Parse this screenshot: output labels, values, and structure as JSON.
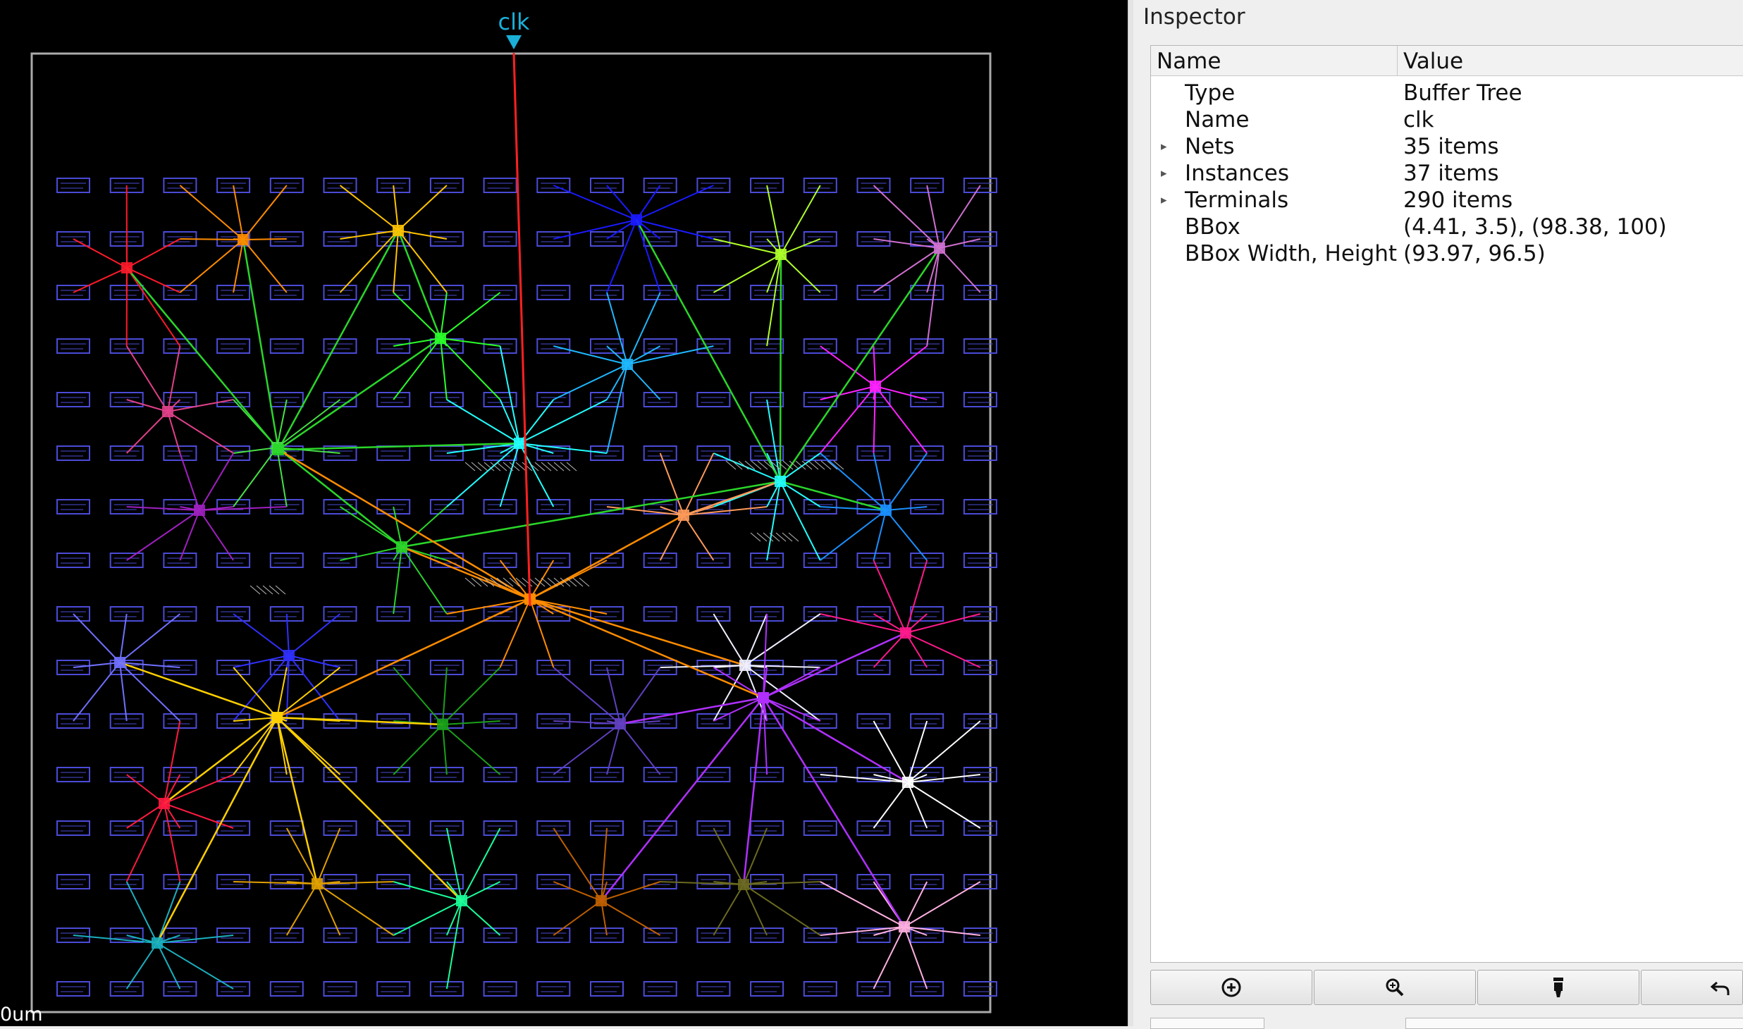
{
  "layout": {
    "clock_pin_label": "clk",
    "scale_label": "0um",
    "bbox_highlight_color": "#aaaaaa",
    "cell_color": "#4b4bd8",
    "root_net_color": "#ff2020"
  },
  "inspector": {
    "title": "Inspector",
    "columns": {
      "name": "Name",
      "value": "Value"
    },
    "rows": [
      {
        "name": "Type",
        "value": "Buffer Tree",
        "expandable": false
      },
      {
        "name": "Name",
        "value": "clk",
        "expandable": false
      },
      {
        "name": "Nets",
        "value": "35 items",
        "expandable": true
      },
      {
        "name": "Instances",
        "value": "37 items",
        "expandable": true
      },
      {
        "name": "Terminals",
        "value": "290 items",
        "expandable": true
      },
      {
        "name": "BBox",
        "value": "(4.41, 3.5), (98.38, 100)",
        "expandable": false
      },
      {
        "name": "BBox Width, Height",
        "value": "(93.97, 96.5)",
        "expandable": false
      }
    ],
    "buttons": [
      {
        "icon": "zoom-to-fit-icon"
      },
      {
        "icon": "zoom-in-icon"
      },
      {
        "icon": "highlight-icon"
      },
      {
        "icon": "undo-icon"
      }
    ]
  }
}
